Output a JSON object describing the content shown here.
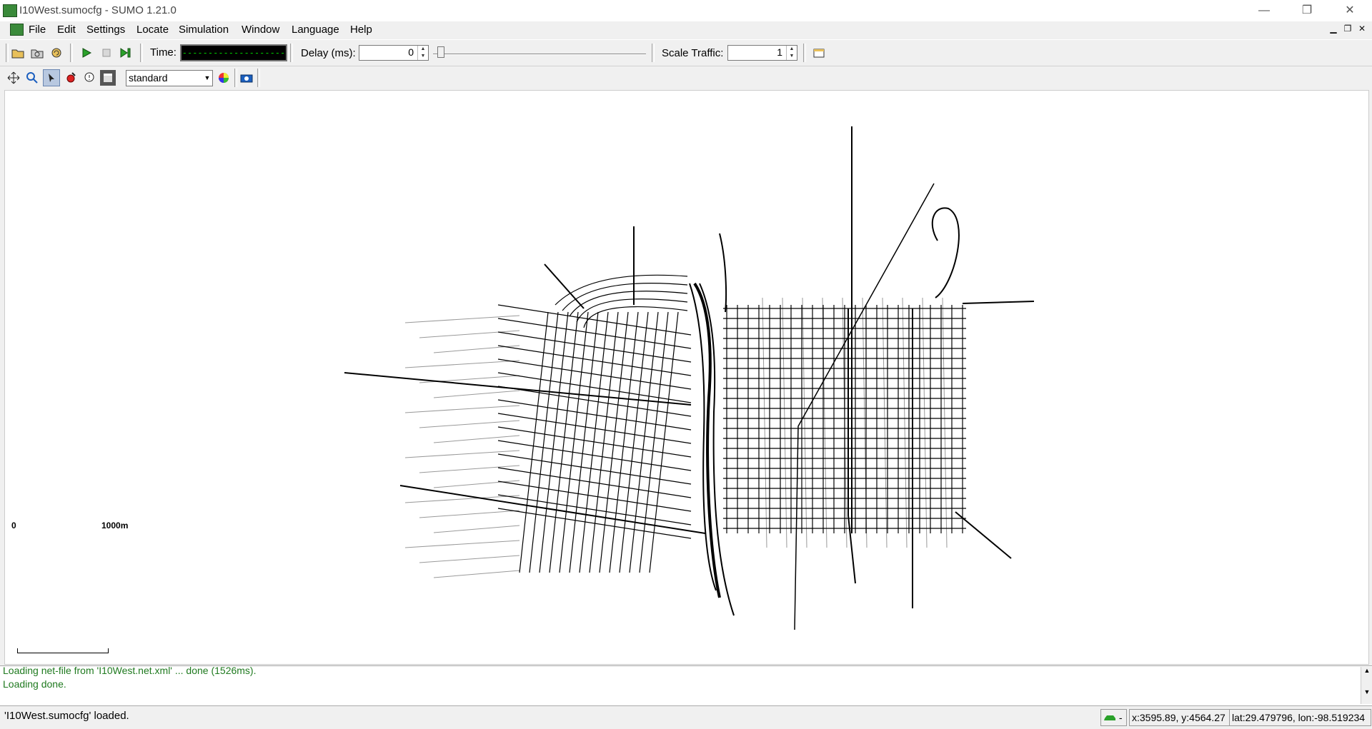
{
  "window": {
    "title": "I10West.sumocfg - SUMO 1.21.0",
    "minimize": "—",
    "restore": "❐",
    "close": "✕"
  },
  "menu": {
    "items": [
      "File",
      "Edit",
      "Settings",
      "Locate",
      "Simulation",
      "Window",
      "Language",
      "Help"
    ]
  },
  "toolbar": {
    "time_label": "Time:",
    "time_value": "--------------------",
    "delay_label": "Delay (ms):",
    "delay_value": "0",
    "scale_label": "Scale Traffic:",
    "scale_value": "1"
  },
  "view": {
    "scheme": "standard"
  },
  "canvas": {
    "scale_start": "0",
    "scale_end": "1000m"
  },
  "messages": {
    "line1": "Loading net-file from 'I10West.net.xml' ... done (1526ms).",
    "line2": "Loading done."
  },
  "status": {
    "text": "'I10West.sumocfg' loaded.",
    "vehicle_indicator": "-",
    "coords": "x:3595.89, y:4564.27",
    "geo": "lat:29.479796, lon:-98.519234"
  },
  "icons": {
    "open": "folder-open-icon",
    "reload": "reload-icon",
    "run": "play-icon",
    "stop": "stop-icon",
    "step": "step-icon",
    "recenter": "recenter-icon",
    "zoom": "zoom-icon",
    "select": "select-icon",
    "color": "color-wheel-icon",
    "screenshot": "camera-icon"
  }
}
